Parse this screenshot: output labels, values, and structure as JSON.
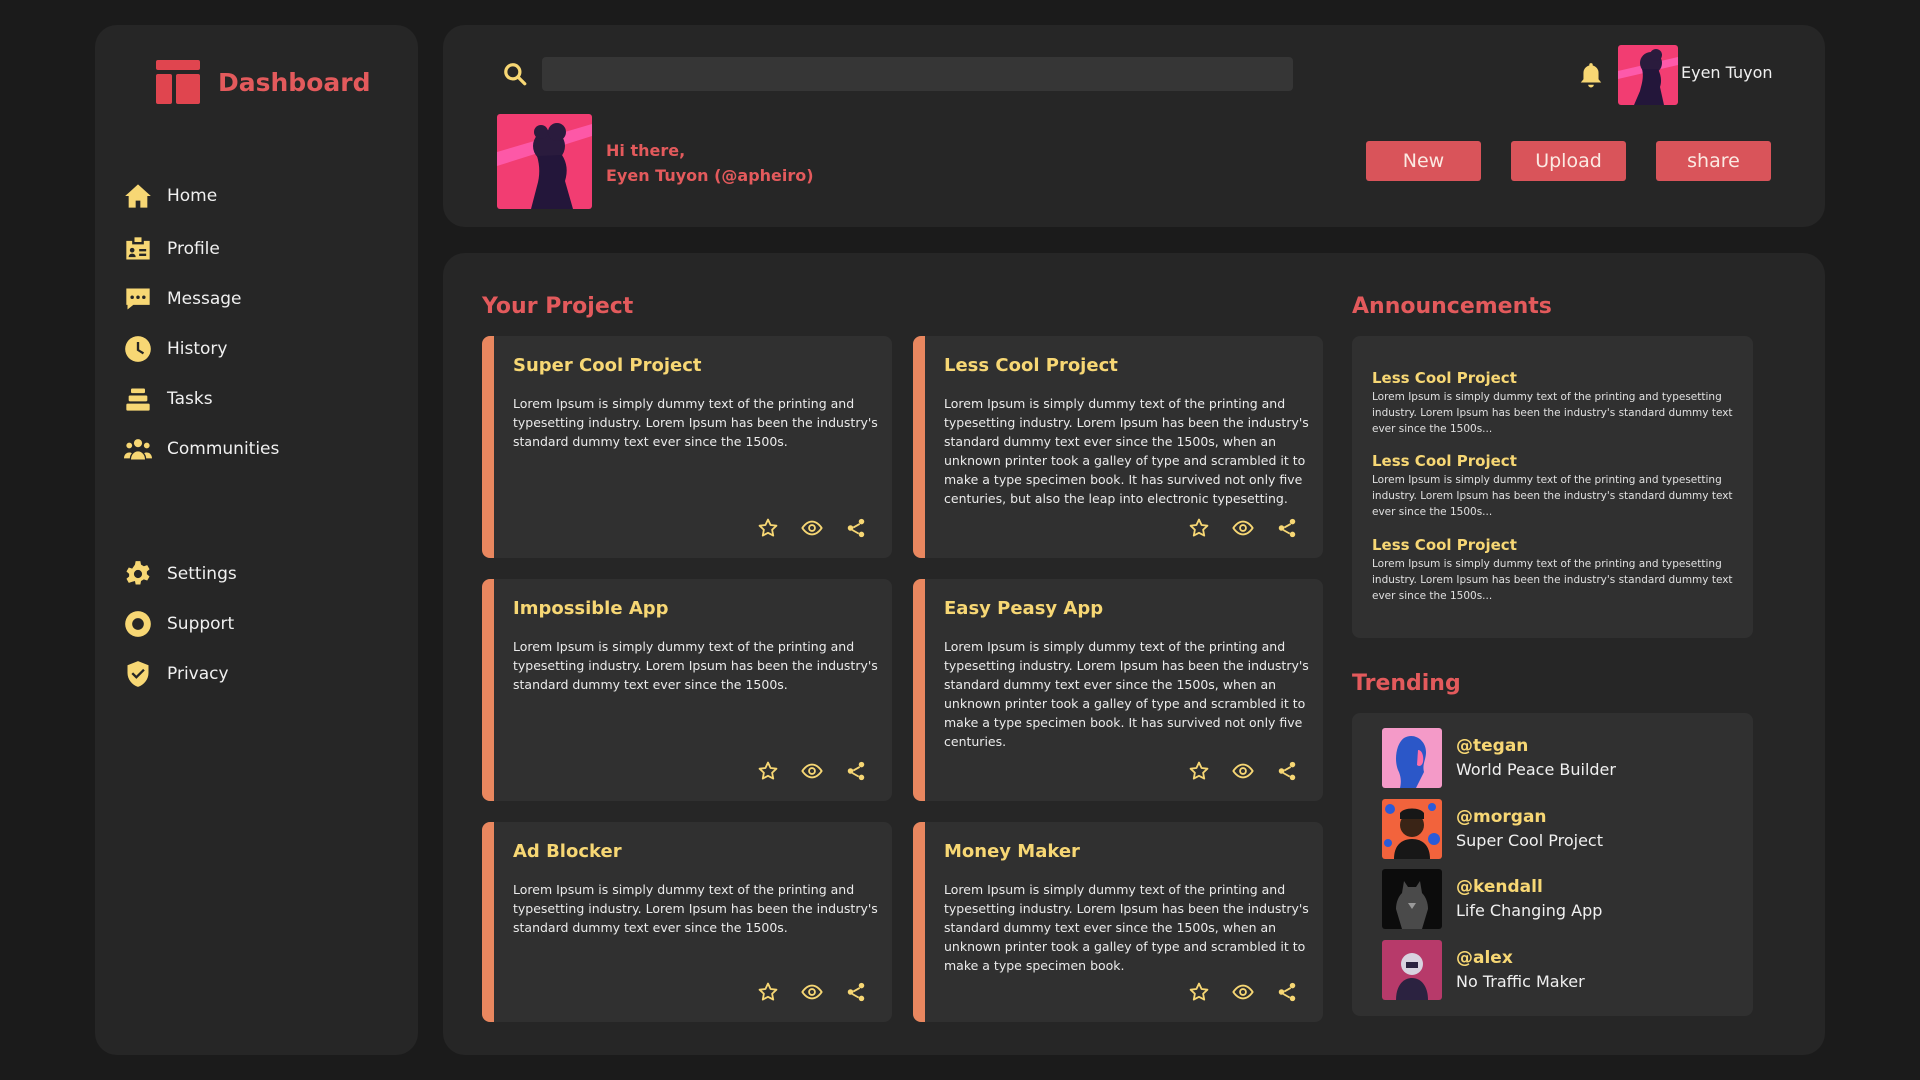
{
  "brand": {
    "title": "Dashboard"
  },
  "nav": {
    "primary": [
      {
        "label": "Home",
        "icon": "home-icon"
      },
      {
        "label": "Profile",
        "icon": "id-card-icon"
      },
      {
        "label": "Message",
        "icon": "chat-icon"
      },
      {
        "label": "History",
        "icon": "clock-icon"
      },
      {
        "label": "Tasks",
        "icon": "stack-icon"
      },
      {
        "label": "Communities",
        "icon": "people-icon"
      }
    ],
    "secondary": [
      {
        "label": "Settings",
        "icon": "gear-icon"
      },
      {
        "label": "Support",
        "icon": "lifebuoy-icon"
      },
      {
        "label": "Privacy",
        "icon": "shield-icon"
      }
    ]
  },
  "header": {
    "search_value": "",
    "user_name": "Eyen Tuyon",
    "greeting": "Hi there,",
    "greeting_name": "Eyen Tuyon (@apheiro)",
    "buttons": {
      "new": "New",
      "upload": "Upload",
      "share": "share"
    }
  },
  "projects": {
    "title": "Your Project",
    "items": [
      {
        "title": "Super Cool Project",
        "body": "Lorem Ipsum is simply dummy text of the printing and typesetting industry. Lorem Ipsum has been the industry's standard dummy text ever since the 1500s."
      },
      {
        "title": "Less Cool Project",
        "body": "Lorem Ipsum is simply dummy text of the printing and typesetting industry. Lorem Ipsum has been the industry's standard dummy text ever since the 1500s, when an unknown printer took a galley of type and scrambled it to make a type specimen book. It has survived not only five centuries, but also the leap into electronic typesetting."
      },
      {
        "title": "Impossible App",
        "body": "Lorem Ipsum is simply dummy text of the printing and typesetting industry. Lorem Ipsum has been the industry's standard dummy text ever since the 1500s."
      },
      {
        "title": "Easy Peasy App",
        "body": "Lorem Ipsum is simply dummy text of the printing and typesetting industry. Lorem Ipsum has been the industry's standard dummy text ever since the 1500s, when an unknown printer took a galley of type and scrambled it to make a type specimen book. It has survived not only five centuries."
      },
      {
        "title": "Ad Blocker",
        "body": "Lorem Ipsum is simply dummy text of the printing and typesetting industry. Lorem Ipsum has been the industry's standard dummy text ever since the 1500s."
      },
      {
        "title": "Money Maker",
        "body": "Lorem Ipsum is simply dummy text of the printing and typesetting industry. Lorem Ipsum has been the industry's standard dummy text ever since the 1500s, when an unknown printer took a galley of type and scrambled it to make a type specimen book."
      }
    ]
  },
  "announcements": {
    "title": "Announcements",
    "items": [
      {
        "title": "Less Cool Project",
        "text": "Lorem Ipsum is simply dummy text of the printing and typesetting industry. Lorem Ipsum has been the industry's standard dummy text ever since the 1500s..."
      },
      {
        "title": "Less Cool Project",
        "text": "Lorem Ipsum is simply dummy text of the printing and typesetting industry. Lorem Ipsum has been the industry's standard dummy text ever since the 1500s..."
      },
      {
        "title": "Less Cool Project",
        "text": "Lorem Ipsum is simply dummy text of the printing and typesetting industry. Lorem Ipsum has been the industry's standard dummy text ever since the 1500s..."
      }
    ]
  },
  "trending": {
    "title": "Trending",
    "items": [
      {
        "handle": "@tegan",
        "desc": "World Peace Builder"
      },
      {
        "handle": "@morgan",
        "desc": "Super Cool Project"
      },
      {
        "handle": "@kendall",
        "desc": "Life Changing App"
      },
      {
        "handle": "@alex",
        "desc": "No Traffic Maker"
      }
    ]
  },
  "colors": {
    "accent": "#e35a5c",
    "highlight": "#f7d774",
    "card_stripe": "#e9875f",
    "panel": "#262626",
    "background": "#1b1b1b"
  }
}
